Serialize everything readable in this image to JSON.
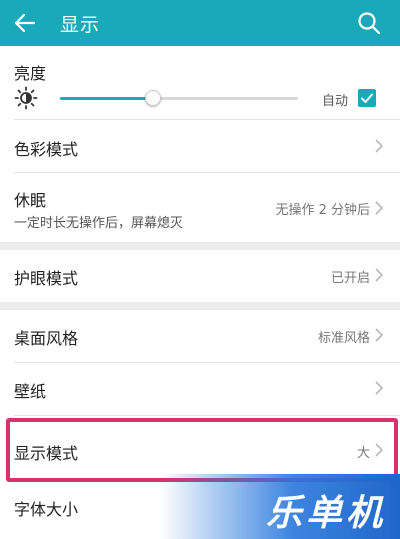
{
  "appbar": {
    "title": "显示"
  },
  "brightness": {
    "label": "亮度",
    "auto_label": "自动",
    "auto_checked": true,
    "level": 0.39
  },
  "items": {
    "color_mode": {
      "label": "色彩模式",
      "value": ""
    },
    "sleep": {
      "label": "休眠",
      "sub": "一定时长无操作后，屏幕熄灭",
      "value": "无操作 2 分钟后"
    },
    "eye_comfort": {
      "label": "护眼模式",
      "value": "已开启"
    },
    "home_style": {
      "label": "桌面风格",
      "value": "标准风格"
    },
    "wallpaper": {
      "label": "壁纸",
      "value": ""
    },
    "display_mode": {
      "label": "显示模式",
      "value": "大"
    },
    "font_size": {
      "label": "字体大小",
      "value": ""
    }
  },
  "watermark": {
    "text": "乐单机"
  },
  "colors": {
    "accent": "#1aa9b8",
    "highlight": "#d6336c"
  }
}
